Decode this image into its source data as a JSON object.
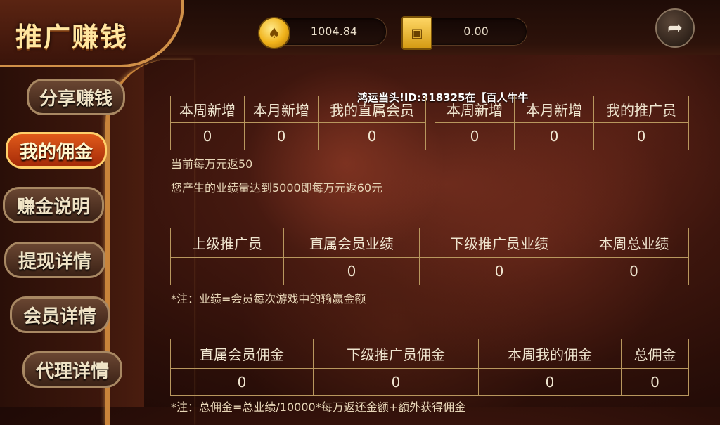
{
  "header": {
    "title": "推广赚钱",
    "coins": "1004.84",
    "safe": "0.00"
  },
  "sidebar": {
    "items": [
      {
        "label": "分享赚钱"
      },
      {
        "label": "我的佣金"
      },
      {
        "label": "赚金说明"
      },
      {
        "label": "提现详情"
      },
      {
        "label": "会员详情"
      },
      {
        "label": "代理详情"
      }
    ]
  },
  "marquee": "鸿运当头!ID:318325在【百人牛牛",
  "stats_left": {
    "headers": [
      "本周新增",
      "本月新增",
      "我的直属会员"
    ],
    "values": [
      "0",
      "0",
      "0"
    ]
  },
  "stats_right": {
    "headers": [
      "本周新增",
      "本月新增",
      "我的推广员"
    ],
    "values": [
      "0",
      "0",
      "0"
    ]
  },
  "rate_current": "当前每万元返50",
  "rate_next": "您产生的业绩量达到5000即每万元返60元",
  "perf_table": {
    "headers": [
      "上级推广员",
      "直属会员业绩",
      "下级推广员业绩",
      "本周总业绩"
    ],
    "values": [
      "",
      "0",
      "0",
      "0"
    ]
  },
  "perf_note": "*注：业绩=会员每次游戏中的输赢金额",
  "comm_table": {
    "headers": [
      "直属会员佣金",
      "下级推广员佣金",
      "本周我的佣金",
      "总佣金"
    ],
    "values": [
      "0",
      "0",
      "0",
      "0"
    ]
  },
  "comm_note": "*注：总佣金=总业绩/10000*每万返还金额+额外获得佣金"
}
